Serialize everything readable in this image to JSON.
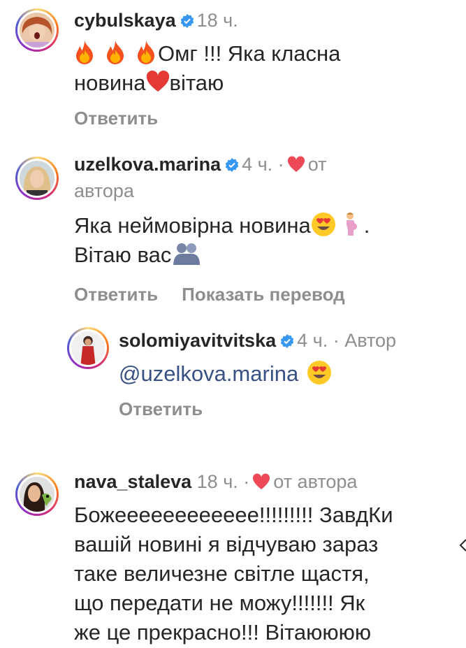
{
  "comments": [
    {
      "username": "cybulskaya",
      "time": "18 ч.",
      "text_line1": "Омг !!! Яка класна",
      "text_line2_a": "новина",
      "text_line2_b": "вітаю",
      "reply_label": "Ответить"
    },
    {
      "username": "uzelkova.marina",
      "time": "4 ч. ·",
      "liked_label": "от",
      "liked_label_2": "автора",
      "text_line1": "Яка неймовірна новина",
      "text_line1_end": ".",
      "text_line2": "Вітаю вас",
      "reply_label": "Ответить",
      "translate_label": "Показать перевод"
    },
    {
      "username": "solomiyavitvitska",
      "time": "4 ч. · Автор",
      "mention": "@uzelkova.marina",
      "reply_label": "Ответить"
    },
    {
      "username": "nava_staleva",
      "time": "18 ч. ·",
      "liked_label": "от автора",
      "text_lines": [
        "Божееееееееееее!!!!!!!!! ЗавдКи",
        "вашій новині я відчуваю зараз",
        "таке величезне світле щастя,",
        "що передати не можу!!!!!!! Як",
        "же це прекрасно!!! Вітаюююю"
      ]
    }
  ],
  "icons": {
    "verified": "verified-badge-icon",
    "heart": "heart-icon",
    "fire": "fire-emoji",
    "smile": "heart-eyes-emoji",
    "pregnant": "pregnant-woman-emoji",
    "hug": "hugging-people-emoji"
  },
  "colors": {
    "verified_blue": "#3897f0",
    "heart_red": "#ed4956",
    "mention_blue": "#385185",
    "meta_gray": "#8e8e8e"
  }
}
